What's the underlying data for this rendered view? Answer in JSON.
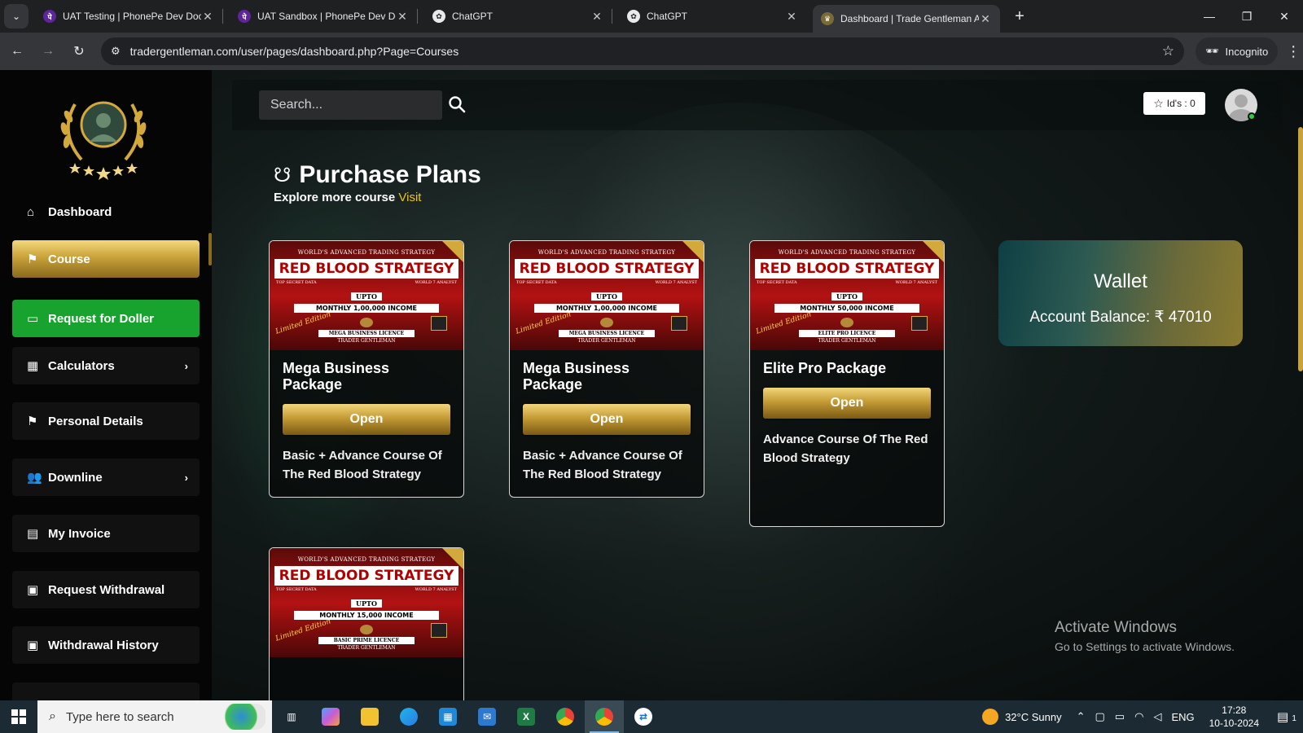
{
  "browser": {
    "tabs": [
      {
        "title": "UAT Testing | PhonePe Dev Doc",
        "favicon": "phonepe-icon",
        "active": false
      },
      {
        "title": "UAT Sandbox | PhonePe Dev Doc",
        "favicon": "phonepe-icon",
        "active": false
      },
      {
        "title": "ChatGPT",
        "favicon": "chatgpt-icon",
        "active": false
      },
      {
        "title": "ChatGPT",
        "favicon": "chatgpt-icon",
        "active": false
      },
      {
        "title": "Dashboard | Trade Gentleman A",
        "favicon": "trade-gentleman-icon",
        "active": true
      }
    ],
    "url": "tradergentleman.com/user/pages/dashboard.php?Page=Courses",
    "incognito_label": "Incognito"
  },
  "sidebar": {
    "items": [
      {
        "label": "Dashboard",
        "icon": "home-icon",
        "style": "plain",
        "chevron": false
      },
      {
        "label": "Course",
        "icon": "flag-icon",
        "style": "gold",
        "chevron": false
      },
      {
        "label": "Request for Doller",
        "icon": "card-icon",
        "style": "green",
        "chevron": false
      },
      {
        "label": "Calculators",
        "icon": "calculator-icon",
        "style": "dark",
        "chevron": true
      },
      {
        "label": "Personal Details",
        "icon": "flag-icon",
        "style": "dark",
        "chevron": false
      },
      {
        "label": "Downline",
        "icon": "users-icon",
        "style": "dark",
        "chevron": true
      },
      {
        "label": "My Invoice",
        "icon": "invoice-icon",
        "style": "dark",
        "chevron": false
      },
      {
        "label": "Request Withdrawal",
        "icon": "money-icon",
        "style": "dark",
        "chevron": false
      },
      {
        "label": "Withdrawal History",
        "icon": "money-icon",
        "style": "dark",
        "chevron": false
      }
    ]
  },
  "header": {
    "search_placeholder": "Search...",
    "ids_label": "Id's : 0"
  },
  "main": {
    "title": "Purchase Plans",
    "subtitle": "Explore more course",
    "visit_link": "Visit",
    "cards": [
      {
        "title": "Mega Business Package",
        "button": "Open",
        "description": "Basic + Advance Course Of The Red Blood Strategy",
        "banner": {
          "top": "WORLD'S ADVANCED TRADING STRATEGY",
          "headline": "RED BLOOD STRATEGY",
          "left_tag": "TOP SECRET DATA",
          "right_tag": "WORLD 7 ANALYST",
          "upto": "UPTO",
          "income": "MONTHLY 1,00,000 INCOME",
          "license": "MEGA BUSINESS LICENCE",
          "brand": "TRADER GENTLEMAN",
          "limited": "Limited Edition"
        }
      },
      {
        "title": "Mega Business Package",
        "button": "Open",
        "description": "Basic + Advance Course Of The Red Blood Strategy",
        "banner": {
          "top": "WORLD'S ADVANCED TRADING STRATEGY",
          "headline": "RED BLOOD STRATEGY",
          "left_tag": "TOP SECRET DATA",
          "right_tag": "WORLD 7 ANALYST",
          "upto": "UPTO",
          "income": "MONTHLY 1,00,000 INCOME",
          "license": "MEGA BUSINESS LICENCE",
          "brand": "TRADER GENTLEMAN",
          "limited": "Limited Edition"
        }
      },
      {
        "title": "Elite Pro Package",
        "button": "Open",
        "description": "Advance Course Of The Red Blood Strategy",
        "banner": {
          "top": "WORLD'S ADVANCED TRADING STRATEGY",
          "headline": "RED BLOOD STRATEGY",
          "left_tag": "TOP SECRET DATA",
          "right_tag": "WORLD 7 ANALYST",
          "upto": "UPTO",
          "income": "MONTHLY 50,000 INCOME",
          "license": "ELITE PRO LICENCE",
          "brand": "TRADER GENTLEMAN",
          "limited": "Limited Edition"
        }
      },
      {
        "title": "",
        "button": "",
        "description": "",
        "banner": {
          "top": "WORLD'S ADVANCED TRADING STRATEGY",
          "headline": "RED BLOOD STRATEGY",
          "left_tag": "TOP SECRET DATA",
          "right_tag": "WORLD 7 ANALYST",
          "upto": "UPTO",
          "income": "MONTHLY 15,000 INCOME",
          "license": "BASIC PRIME LICENCE",
          "brand": "TRADER GENTLEMAN",
          "limited": "Limited Edition"
        }
      }
    ]
  },
  "wallet": {
    "title": "Wallet",
    "balance_label": "Account Balance: ₹ 47010"
  },
  "watermark": {
    "line1": "Activate Windows",
    "line2": "Go to Settings to activate Windows."
  },
  "taskbar": {
    "search_placeholder": "Type here to search",
    "weather": "32°C  Sunny",
    "language": "ENG",
    "time": "17:28",
    "date": "10-10-2024",
    "notification_count": "1"
  },
  "colors": {
    "accent_gold": "#c9a23a",
    "accent_green": "#17a32e",
    "link_yellow": "#f1c40f",
    "banner_red": "#b31212"
  }
}
